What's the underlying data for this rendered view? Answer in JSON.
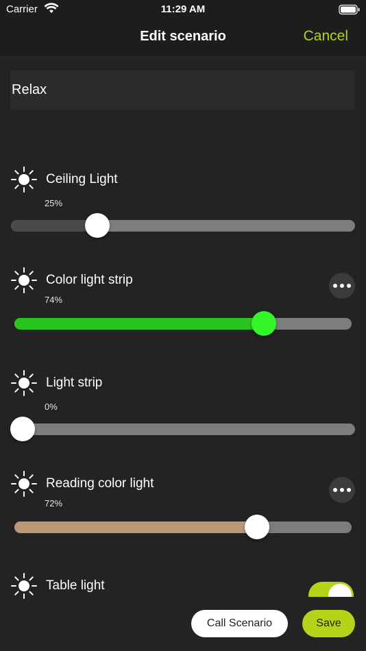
{
  "status_bar": {
    "carrier": "Carrier",
    "time": "11:29 AM",
    "icons": [
      "wifi-icon",
      "battery-icon"
    ]
  },
  "nav": {
    "title": "Edit scenario",
    "cancel_label": "Cancel"
  },
  "scenario_name": {
    "value": "Relax"
  },
  "lights": [
    {
      "name": "Ceiling Light",
      "level_label": "25%",
      "level": 0.25,
      "fill_color": "#4a4a4a",
      "knob_color": "#ffffff",
      "has_more": false,
      "icon": "sun-icon"
    },
    {
      "name": "Color light strip",
      "level_label": "74%",
      "level": 0.74,
      "fill_color": "#2ac41e",
      "knob_color": "#34f52a",
      "has_more": true,
      "icon": "sun-icon"
    },
    {
      "name": "Light strip",
      "level_label": "0%",
      "level": 0.0,
      "fill_color": "#7d7d7d",
      "knob_color": "#ffffff",
      "has_more": false,
      "icon": "sun-icon"
    },
    {
      "name": "Reading color light",
      "level_label": "72%",
      "level": 0.72,
      "fill_color": "#b89876",
      "knob_color": "#ffffff",
      "has_more": true,
      "icon": "sun-icon"
    },
    {
      "name": "Table light",
      "toggle_on": true,
      "toggle_color": "#b5d319",
      "has_more": false,
      "icon": "sun-icon"
    }
  ],
  "buttons": {
    "call_scenario": "Call Scenario",
    "save": "Save"
  },
  "colors": {
    "accent": "#b5d319",
    "background": "#232323",
    "track": "#7d7d7d"
  }
}
